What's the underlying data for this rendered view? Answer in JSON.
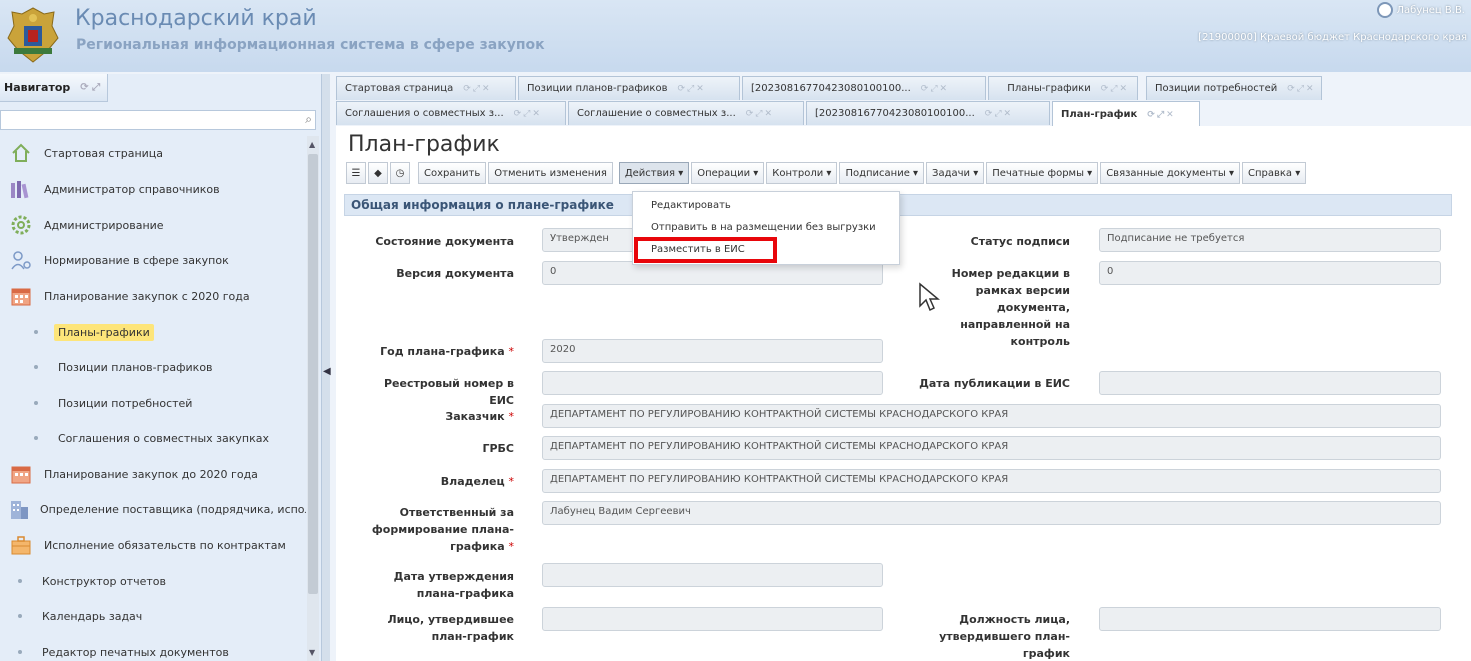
{
  "header": {
    "region": "Краснодарский край",
    "subtitle": "Региональная информационная система в сфере закупок",
    "user": "Лабунец В.В.",
    "org": "[21900000] Краевой бюджет Краснодарского края"
  },
  "navigator": {
    "title": "Навигатор",
    "items": [
      {
        "label": "Стартовая страница",
        "icon": "home-icon"
      },
      {
        "label": "Администратор справочников",
        "icon": "books-icon"
      },
      {
        "label": "Администрирование",
        "icon": "gear-icon"
      },
      {
        "label": "Нормирование в сфере закупок",
        "icon": "user-settings-icon"
      },
      {
        "label": "Планирование закупок с 2020 года",
        "icon": "calendar-icon"
      },
      {
        "label": "Планы-графики",
        "icon": "bullet-icon",
        "selected": true
      },
      {
        "label": "Позиции планов-графиков",
        "icon": "bullet-icon"
      },
      {
        "label": "Позиции потребностей",
        "icon": "bullet-icon"
      },
      {
        "label": "Соглашения о совместных закупках",
        "icon": "bullet-icon"
      },
      {
        "label": "Планирование закупок до 2020 года",
        "icon": "calendar-icon"
      },
      {
        "label": "Определение поставщика (подрядчика, исполн",
        "icon": "building-icon"
      },
      {
        "label": "Исполнение обязательств по контрактам",
        "icon": "briefcase-icon"
      },
      {
        "label": "Конструктор отчетов",
        "icon": "bullet-icon"
      },
      {
        "label": "Календарь задач",
        "icon": "bullet-icon"
      },
      {
        "label": "Редактор печатных документов",
        "icon": "bullet-icon"
      }
    ]
  },
  "tabs": {
    "row1": [
      "Стартовая страница",
      "Позиции планов-графиков",
      "[20230816770423080100100...",
      "Планы-графики",
      "Позиции потребностей"
    ],
    "row2": [
      "Соглашения о совместных з...",
      "Соглашение о совместных з...",
      "[20230816770423080100100...",
      "План-график"
    ]
  },
  "page": {
    "title": "План-график",
    "toolbar": [
      "Сохранить",
      "Отменить изменения",
      "Действия ▾",
      "Операции ▾",
      "Контроли ▾",
      "Подписание ▾",
      "Задачи ▾",
      "Печатные формы ▾",
      "Связанные документы ▾",
      "Справка ▾"
    ],
    "section_title": "Общая информация о плане-графике",
    "fields": {
      "doc_state_label": "Состояние документа",
      "doc_state_value": "Утвержден",
      "doc_version_label": "Версия документа",
      "doc_version_value": "0",
      "sign_status_label": "Статус подписи",
      "sign_status_value": "Подписание не требуется",
      "revision_label": "Номер редакции в рамках версии документа, направленной на контроль",
      "revision_value": "0",
      "year_label": "Год плана-графика",
      "year_value": "2020",
      "reg_number_label": "Реестровый номер в ЕИС",
      "reg_number_value": "",
      "pub_date_label": "Дата публикации в ЕИС",
      "pub_date_value": "",
      "customer_label": "Заказчик",
      "customer_value": "ДЕПАРТАМЕНТ ПО РЕГУЛИРОВАНИЮ КОНТРАКТНОЙ СИСТЕМЫ КРАСНОДАРСКОГО КРАЯ",
      "grbs_label": "ГРБС",
      "grbs_value": "ДЕПАРТАМЕНТ ПО РЕГУЛИРОВАНИЮ КОНТРАКТНОЙ СИСТЕМЫ КРАСНОДАРСКОГО КРАЯ",
      "owner_label": "Владелец",
      "owner_value": "ДЕПАРТАМЕНТ ПО РЕГУЛИРОВАНИЮ КОНТРАКТНОЙ СИСТЕМЫ КРАСНОДАРСКОГО КРАЯ",
      "responsible_label": "Ответственный за формирование плана-графика",
      "responsible_value": "Лабунец Вадим Сергеевич",
      "approval_date_label": "Дата утверждения плана-графика",
      "approval_date_value": "",
      "approver_label": "Лицо, утвердившее план-график",
      "approver_value": "",
      "approver_position_label": "Должность лица, утвердившего план-график",
      "approver_position_value": ""
    }
  },
  "actions_menu": {
    "items": [
      "Редактировать",
      "Отправить в на размещении без выгрузки",
      "Разместить в ЕИС"
    ]
  },
  "colors": {
    "highlight_border": "#e8060b",
    "selected_nav": "#fde57a"
  }
}
